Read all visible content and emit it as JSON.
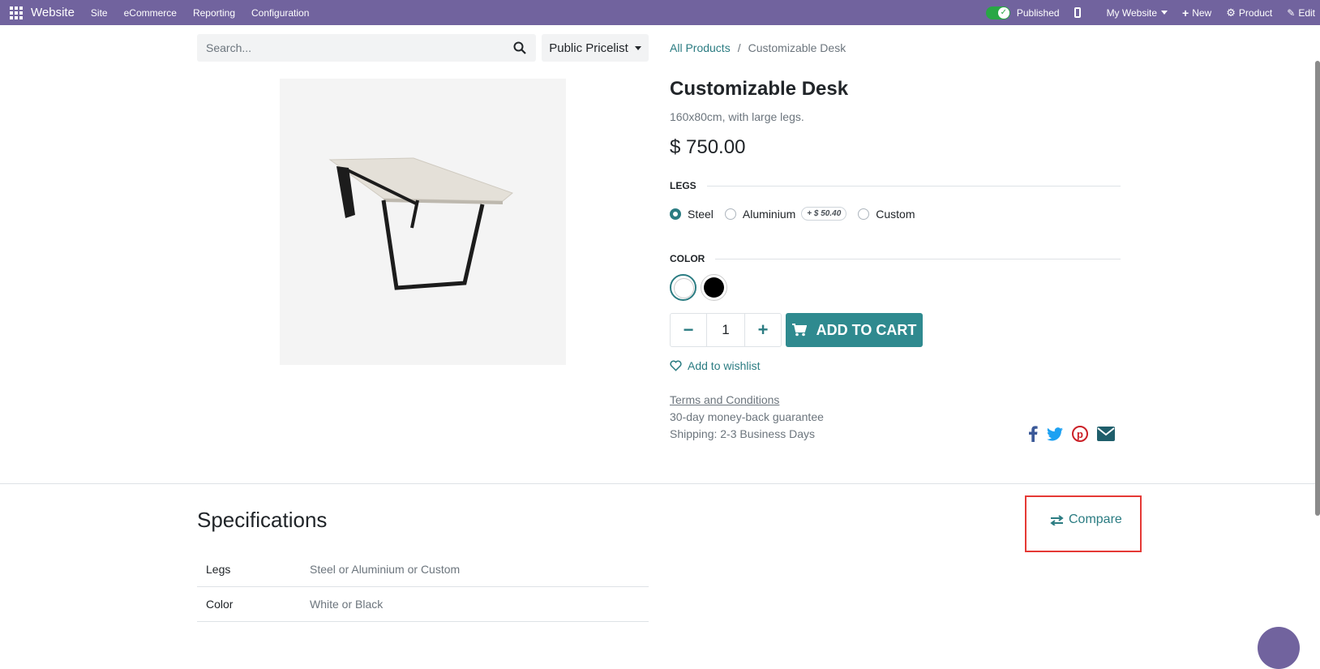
{
  "topbar": {
    "brand": "Website",
    "menus": [
      "Site",
      "eCommerce",
      "Reporting",
      "Configuration"
    ],
    "published_label": "Published",
    "website_label": "My Website",
    "new_label": "New",
    "product_label": "Product",
    "edit_label": "Edit",
    "bg_color": "#71639e"
  },
  "search": {
    "placeholder": "Search..."
  },
  "pricelist": {
    "label": "Public Pricelist"
  },
  "breadcrumb": {
    "link": "All Products",
    "separator": "/",
    "current": "Customizable Desk"
  },
  "product": {
    "name": "Customizable Desk",
    "description": "160x80cm, with large legs.",
    "price": "$ 750.00",
    "legs_label": "LEGS",
    "legs_options": [
      {
        "label": "Steel",
        "selected": true
      },
      {
        "label": "Aluminium",
        "extra": "+ $ 50.40",
        "selected": false
      },
      {
        "label": "Custom",
        "selected": false
      }
    ],
    "color_label": "COLOR",
    "colors": [
      {
        "name": "White",
        "value": "#ffffff",
        "selected": true
      },
      {
        "name": "Black",
        "value": "#000000",
        "selected": false
      }
    ],
    "quantity": "1",
    "add_to_cart": "ADD TO CART",
    "wishlist": "Add to wishlist",
    "terms": "Terms and Conditions",
    "guarantee": "30-day money-back guarantee",
    "shipping": "Shipping: 2-3 Business Days",
    "share_icons": [
      "facebook-icon",
      "twitter-icon",
      "pinterest-icon",
      "envelope-icon"
    ]
  },
  "specifications": {
    "title": "Specifications",
    "compare_label": "Compare",
    "rows": [
      {
        "key": "Legs",
        "value": "Steel or Aluminium or Custom"
      },
      {
        "key": "Color",
        "value": "White or Black"
      }
    ]
  },
  "colors": {
    "accent": "#2b7c82",
    "cart": "#2f8a8f",
    "highlight": "#e53935"
  }
}
